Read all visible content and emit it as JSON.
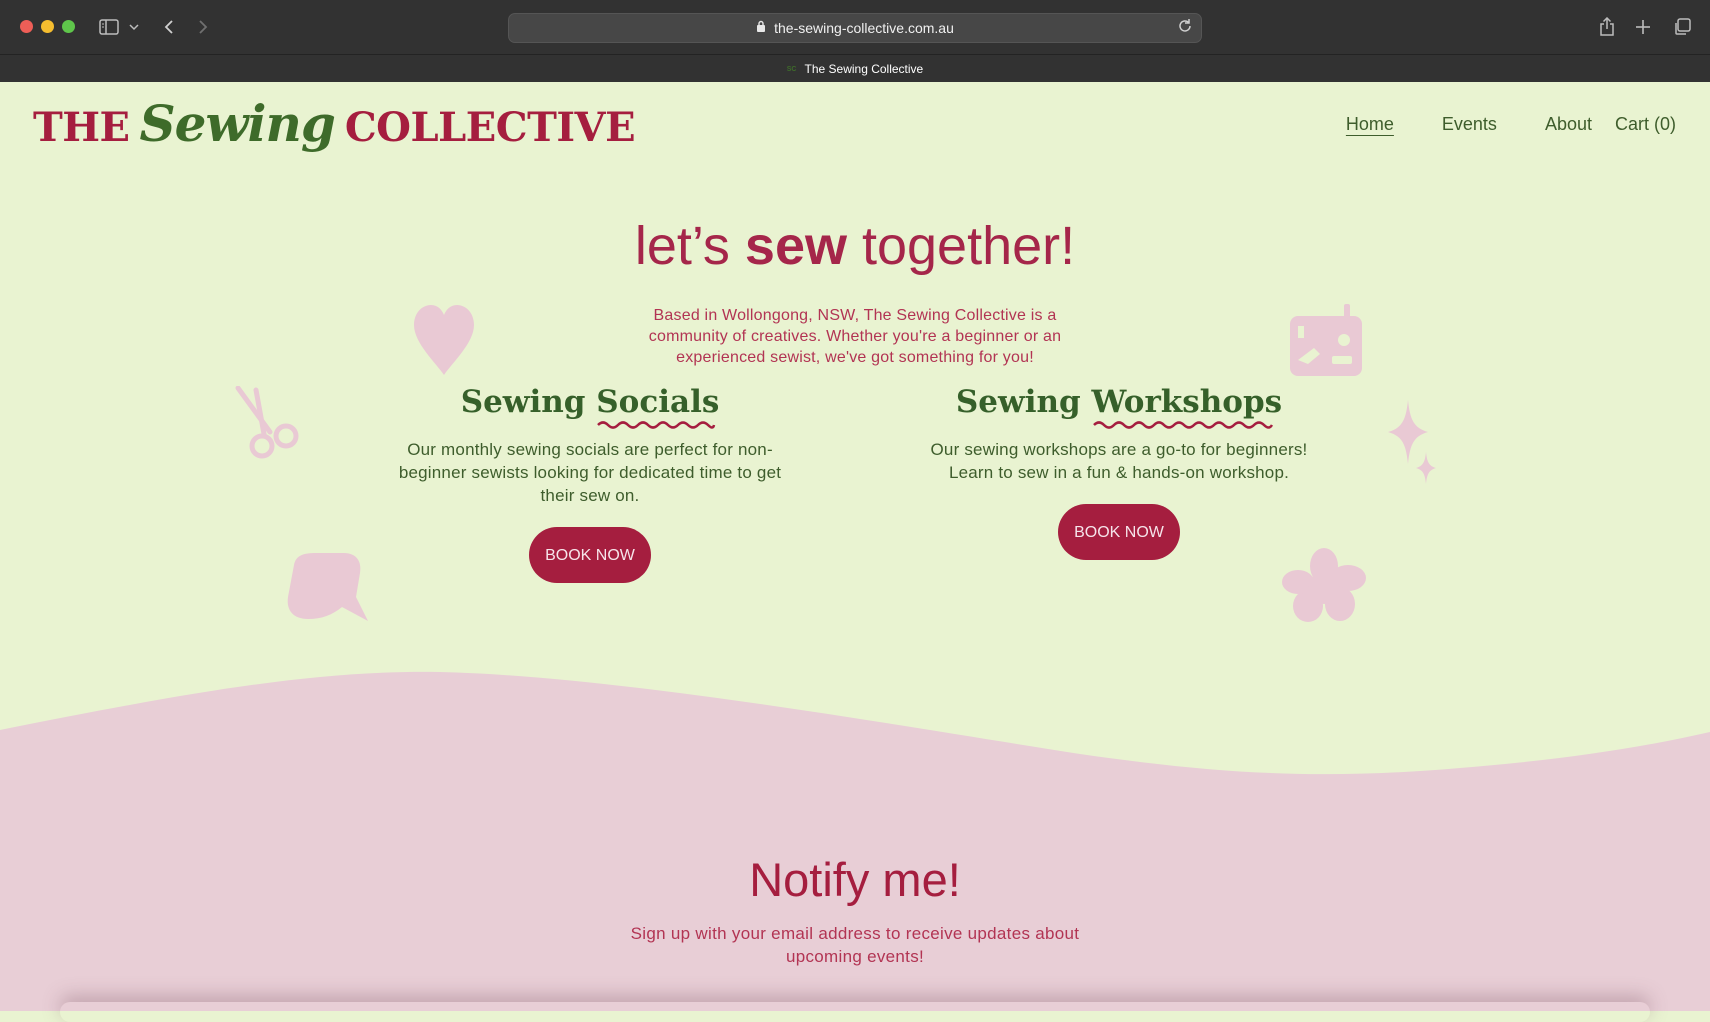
{
  "browser": {
    "url": "the-sewing-collective.com.au",
    "tab_title": "The Sewing Collective",
    "favicon_text": "SC"
  },
  "logo": {
    "the": "THE",
    "sewing": "Sewing",
    "collective": "COLLECTIVE"
  },
  "nav": {
    "items": [
      {
        "label": "Home",
        "active": true
      },
      {
        "label": "Events"
      },
      {
        "label": "About"
      },
      {
        "label": "Cart (0)"
      }
    ]
  },
  "hero": {
    "title_pre": "let’s ",
    "title_bold": "sew",
    "title_post": " together!",
    "description": "Based in Wollongong, NSW, The Sewing Collective is a community of creatives. Whether you're a beginner or an experienced sewist, we've got something for you!"
  },
  "cards": [
    {
      "title_a": "Sewing",
      "title_b": "Socials",
      "text": "Our monthly sewing socials are perfect for non-beginner sewists looking for dedicated time to get their sew on.",
      "button": "BOOK NOW"
    },
    {
      "title_a": "Sewing",
      "title_b": "Workshops",
      "text": "Our sewing workshops are a go-to for beginners! Learn to sew in a fun & hands-on workshop.",
      "button": "BOOK NOW"
    }
  ],
  "notify": {
    "title": "Notify me!",
    "description": "Sign up with your email address to receive updates about upcoming events!"
  },
  "colors": {
    "background": "#e9f3d1",
    "accent_red": "#a51e3f",
    "accent_green": "#3e6b2a",
    "pink": "#e8ced6",
    "deco_pink": "#e9c9d4"
  },
  "icons": [
    "sidebar-icon",
    "back-icon",
    "forward-icon",
    "lock-icon",
    "reload-icon",
    "share-icon",
    "new-tab-icon",
    "tabs-icon",
    "heart-icon",
    "scissors-icon",
    "speech-bubble-icon",
    "sewing-machine-icon",
    "sparkle-icon",
    "flower-icon"
  ]
}
